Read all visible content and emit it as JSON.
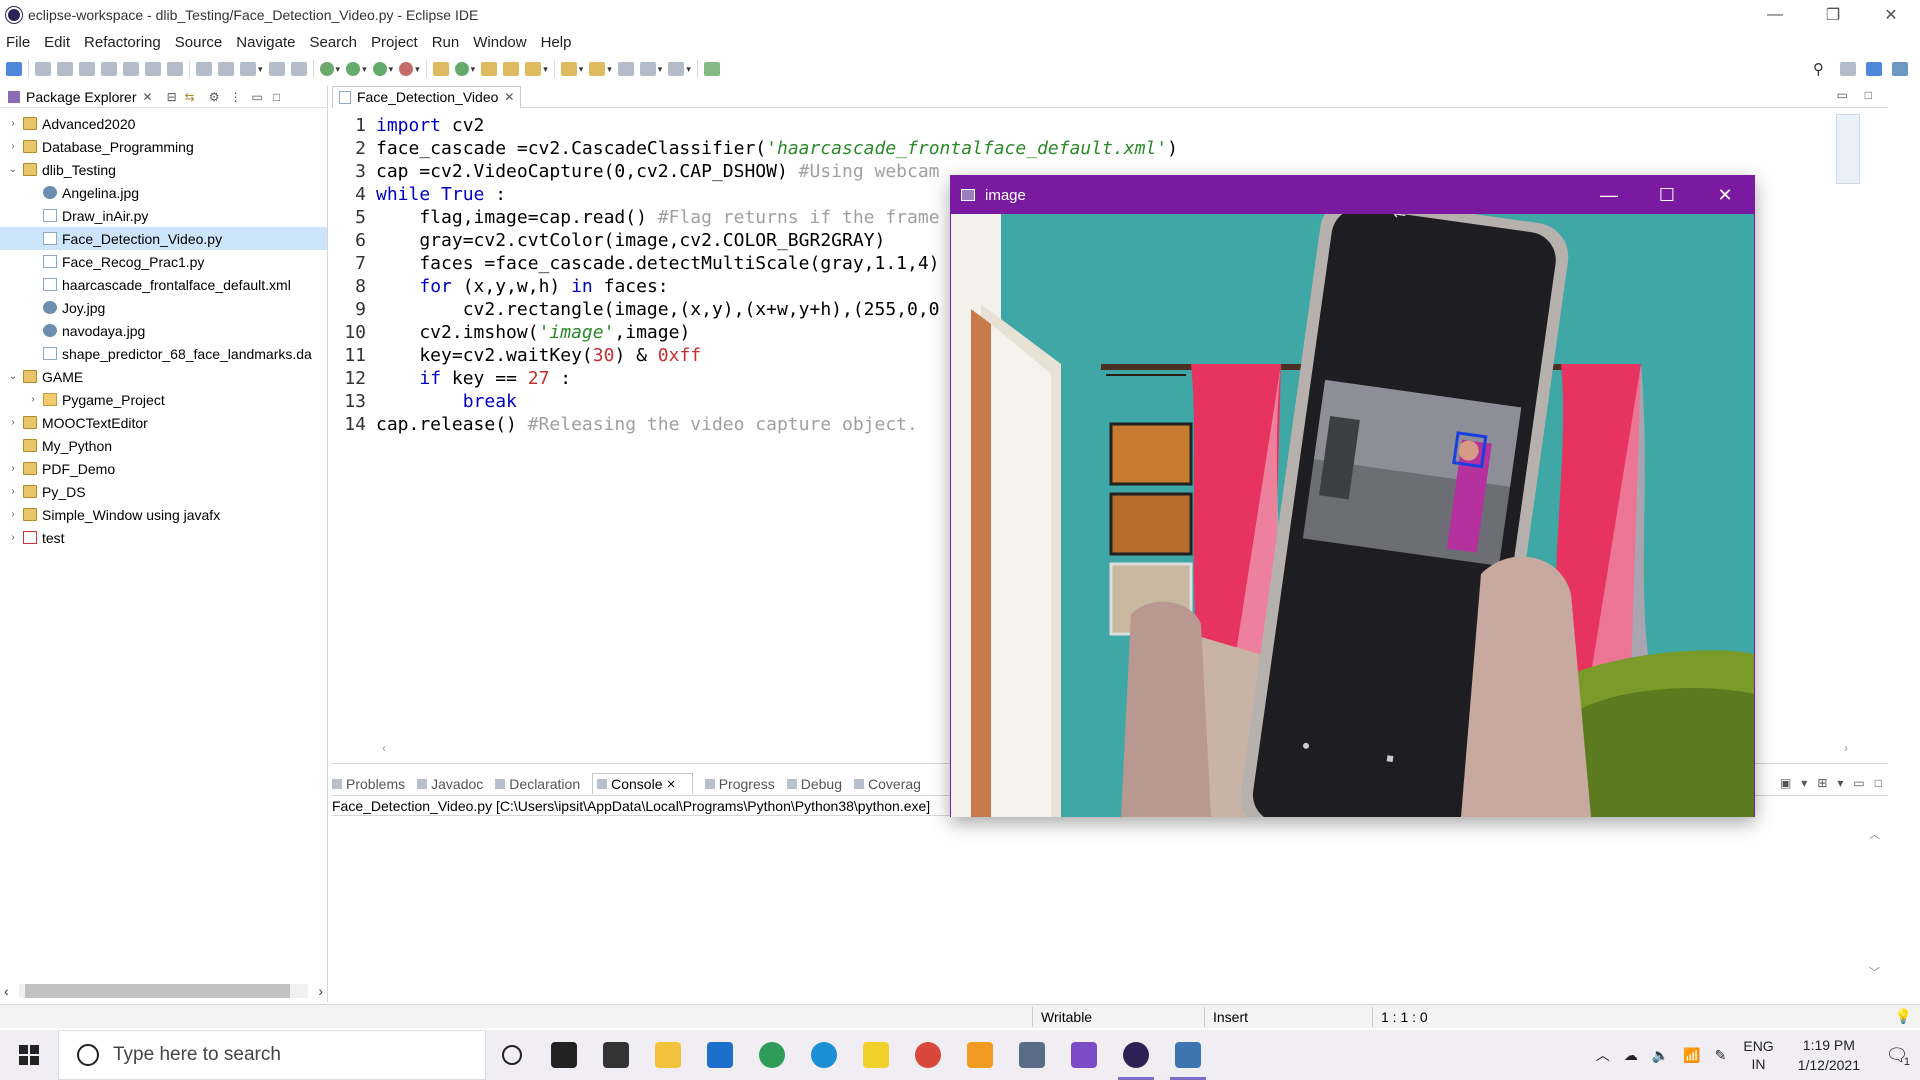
{
  "window": {
    "title": "eclipse-workspace - dlib_Testing/Face_Detection_Video.py - Eclipse IDE",
    "minimize": "—",
    "restore": "❐",
    "close": "✕"
  },
  "menu": [
    "File",
    "Edit",
    "Refactoring",
    "Source",
    "Navigate",
    "Search",
    "Project",
    "Run",
    "Window",
    "Help"
  ],
  "package_explorer": {
    "tab_label": "Package Explorer",
    "items": [
      {
        "label": "Advanced2020",
        "arrow": "›",
        "icon": "project"
      },
      {
        "label": "Database_Programming",
        "arrow": "›",
        "icon": "project"
      },
      {
        "label": "dlib_Testing",
        "arrow": "⌄",
        "icon": "project"
      },
      {
        "label": "Angelina.jpg",
        "arrow": "",
        "icon": "image",
        "indent": 1
      },
      {
        "label": "Draw_inAir.py",
        "arrow": "",
        "icon": "file",
        "indent": 1
      },
      {
        "label": "Face_Detection_Video.py",
        "arrow": "",
        "icon": "file",
        "indent": 1,
        "selected": true
      },
      {
        "label": "Face_Recog_Prac1.py",
        "arrow": "",
        "icon": "file",
        "indent": 1
      },
      {
        "label": "haarcascade_frontalface_default.xml",
        "arrow": "",
        "icon": "xml",
        "indent": 1
      },
      {
        "label": "Joy.jpg",
        "arrow": "",
        "icon": "image",
        "indent": 1
      },
      {
        "label": "navodaya.jpg",
        "arrow": "",
        "icon": "image",
        "indent": 1
      },
      {
        "label": "shape_predictor_68_face_landmarks.da",
        "arrow": "",
        "icon": "file",
        "indent": 1
      },
      {
        "label": "GAME",
        "arrow": "⌄",
        "icon": "project"
      },
      {
        "label": "Pygame_Project",
        "arrow": "›",
        "icon": "folder",
        "indent": 1
      },
      {
        "label": "MOOCTextEditor",
        "arrow": "›",
        "icon": "project"
      },
      {
        "label": "My_Python",
        "arrow": "",
        "icon": "project"
      },
      {
        "label": "PDF_Demo",
        "arrow": "›",
        "icon": "project"
      },
      {
        "label": "Py_DS",
        "arrow": "›",
        "icon": "project"
      },
      {
        "label": "Simple_Window using javafx",
        "arrow": "›",
        "icon": "project"
      },
      {
        "label": "test",
        "arrow": "›",
        "icon": "error-project"
      }
    ]
  },
  "editor": {
    "tab_label": "Face_Detection_Video",
    "lines": [
      {
        "n": "1",
        "text": "import cv2"
      },
      {
        "n": "2",
        "text": "face_cascade =cv2.CascadeClassifier('haarcascade_frontalface_default.xml')"
      },
      {
        "n": "3",
        "text": "cap =cv2.VideoCapture(0,cv2.CAP_DSHOW) #Using webcam"
      },
      {
        "n": "4",
        "text": "while True :"
      },
      {
        "n": "5",
        "text": "    flag,image=cap.read() #Flag returns if the frame"
      },
      {
        "n": "6",
        "text": "    gray=cv2.cvtColor(image,cv2.COLOR_BGR2GRAY)"
      },
      {
        "n": "7",
        "text": "    faces =face_cascade.detectMultiScale(gray,1.1,4)"
      },
      {
        "n": "8",
        "text": "    for (x,y,w,h) in faces:"
      },
      {
        "n": "9",
        "text": "        cv2.rectangle(image,(x,y),(x+w,y+h),(255,0,0"
      },
      {
        "n": "10",
        "text": "    cv2.imshow('image',image)"
      },
      {
        "n": "11",
        "text": "    key=cv2.waitKey(30) & 0xff"
      },
      {
        "n": "12",
        "text": "    if key == 27 :"
      },
      {
        "n": "13",
        "text": "        break"
      },
      {
        "n": "14",
        "text": "cap.release() #Releasing the video capture object."
      }
    ]
  },
  "bottom_tabs": [
    "Problems",
    "Javadoc",
    "Declaration",
    "Console",
    "Progress",
    "Debug",
    "Coverag"
  ],
  "console": {
    "active_tab": "Console",
    "path": "Face_Detection_Video.py [C:\\Users\\ipsit\\AppData\\Local\\Programs\\Python\\Python38\\python.exe]"
  },
  "statusbar": {
    "writable": "Writable",
    "insert": "Insert",
    "position": "1 : 1 : 0"
  },
  "cv_window": {
    "title": "image"
  },
  "taskbar": {
    "search_placeholder": "Type here to search",
    "lang_line1": "ENG",
    "lang_line2": "IN",
    "time": "1:19 PM",
    "date": "1/12/2021",
    "notif_count": "1",
    "apps": [
      {
        "name": "task-view",
        "color": "#222"
      },
      {
        "name": "store",
        "color": "#333"
      },
      {
        "name": "explorer",
        "color": "#f3c23c"
      },
      {
        "name": "mail",
        "color": "#1e6fc9"
      },
      {
        "name": "maps",
        "color": "#2f9c5a"
      },
      {
        "name": "edge",
        "color": "#1a8fd6"
      },
      {
        "name": "sticky",
        "color": "#f2d12a"
      },
      {
        "name": "chrome",
        "color": "#d9473b"
      },
      {
        "name": "sublime",
        "color": "#f29b22"
      },
      {
        "name": "photos",
        "color": "#5a6b86"
      },
      {
        "name": "visual-studio",
        "color": "#7b4cc6"
      },
      {
        "name": "eclipse",
        "color": "#2c2255"
      },
      {
        "name": "python",
        "color": "#3d75b0"
      }
    ]
  }
}
